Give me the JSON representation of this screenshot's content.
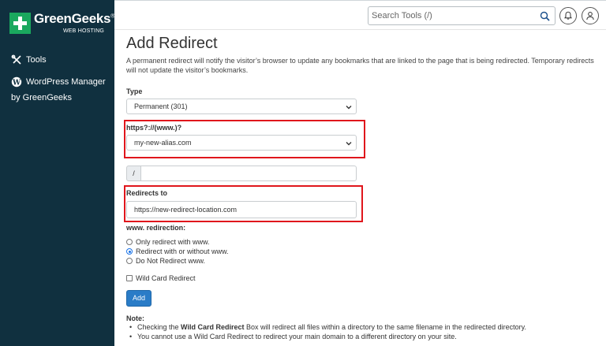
{
  "brand": {
    "name": "GreenGeeks",
    "registered": "®",
    "subtitle": "WEB HOSTING"
  },
  "sidebar": {
    "items": [
      {
        "label": "Tools",
        "icon": "tools-icon"
      },
      {
        "label": "WordPress Manager",
        "label_line2": "by GreenGeeks",
        "icon": "wordpress-icon"
      }
    ]
  },
  "header": {
    "search_placeholder": "Search Tools (/)"
  },
  "page": {
    "title": "Add Redirect",
    "description": "A permanent redirect will notify the visitor’s browser to update any bookmarks that are linked to the page that is being redirected. Temporary redirects will not update the visitor’s bookmarks."
  },
  "form": {
    "type_label": "Type",
    "type_value": "Permanent (301)",
    "domain_label": "https?://(www.)?",
    "domain_value": "my-new-alias.com",
    "path_prefix": "/",
    "path_value": "",
    "redirects_to_label": "Redirects to",
    "redirects_to_value": "https://new-redirect-location.com",
    "www_label": "www. redirection:",
    "www_options": [
      {
        "label": "Only redirect with www.",
        "selected": false
      },
      {
        "label": "Redirect with or without www.",
        "selected": true
      },
      {
        "label": "Do Not Redirect www.",
        "selected": false
      }
    ],
    "wildcard_label": "Wild Card Redirect",
    "wildcard_checked": false,
    "add_button": "Add"
  },
  "note": {
    "title": "Note:",
    "item1_before": "Checking the ",
    "item1_bold": "Wild Card Redirect",
    "item1_after": " Box will redirect all files within a directory to the same filename in the redirected directory.",
    "item2": "You cannot use a Wild Card Redirect to redirect your main domain to a different directory on your site."
  },
  "colors": {
    "sidebar_bg": "#10303f",
    "brand_green": "#1aa85e",
    "highlight_red": "#e0161c",
    "button_blue": "#2a7cc7"
  }
}
